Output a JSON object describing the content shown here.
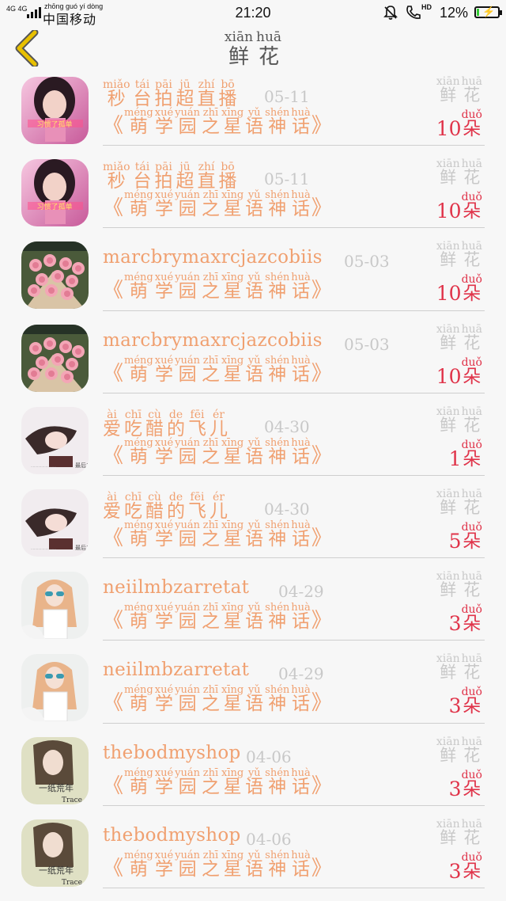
{
  "status_bar": {
    "network": "4G 4G",
    "carrier_pinyin": [
      "zhōng",
      "guó",
      "yí",
      "dòng"
    ],
    "carrier": [
      "中",
      "国",
      "移",
      "动"
    ],
    "time": "21:20",
    "hd": "HD",
    "battery_pct": "12%",
    "battery_level": 0.12
  },
  "header": {
    "title": [
      {
        "py": "xiān",
        "hz": "鲜"
      },
      {
        "py": "huā",
        "hz": "花"
      }
    ]
  },
  "flower_label": [
    {
      "py": "xiān",
      "hz": "鲜"
    },
    {
      "py": "huā",
      "hz": "花"
    }
  ],
  "unit": {
    "py": "duǒ",
    "hz": "朵"
  },
  "show_title": [
    {
      "py": "méng",
      "hz": "萌"
    },
    {
      "py": "xué",
      "hz": "学"
    },
    {
      "py": "yuán",
      "hz": "园"
    },
    {
      "py": "zhī",
      "hz": "之"
    },
    {
      "py": "xīng",
      "hz": "星"
    },
    {
      "py": "yǔ",
      "hz": "语"
    },
    {
      "py": "shén",
      "hz": "神"
    },
    {
      "py": "huà",
      "hz": "话"
    }
  ],
  "brackets": {
    "open": "《",
    "close": "》"
  },
  "rows": [
    {
      "name_type": "cn",
      "name": [
        {
          "py": "miǎo",
          "hz": "秒"
        },
        {
          "py": "tái",
          "hz": "台"
        },
        {
          "py": "pāi",
          "hz": "拍"
        },
        {
          "py": "jū",
          "hz": "超"
        },
        {
          "py": "zhí",
          "hz": "直"
        },
        {
          "py": "bō",
          "hz": "播"
        }
      ],
      "date": "05-11",
      "count": "10",
      "avatar": "girl-pink"
    },
    {
      "name_type": "cn",
      "name": [
        {
          "py": "miǎo",
          "hz": "秒"
        },
        {
          "py": "tái",
          "hz": "台"
        },
        {
          "py": "pāi",
          "hz": "拍"
        },
        {
          "py": "jū",
          "hz": "超"
        },
        {
          "py": "zhí",
          "hz": "直"
        },
        {
          "py": "bō",
          "hz": "播"
        }
      ],
      "date": "05-11",
      "count": "10",
      "avatar": "girl-pink"
    },
    {
      "name_type": "latin",
      "name_text": "marcbrymaxrcjazcobiis",
      "date": "05-03",
      "count": "10",
      "avatar": "roses"
    },
    {
      "name_type": "latin",
      "name_text": "marcbrymaxrcjazcobiis",
      "date": "05-03",
      "count": "10",
      "avatar": "roses"
    },
    {
      "name_type": "cn",
      "name": [
        {
          "py": "ài",
          "hz": "爱"
        },
        {
          "py": "chī",
          "hz": "吃"
        },
        {
          "py": "cù",
          "hz": "醋"
        },
        {
          "py": "de",
          "hz": "的"
        },
        {
          "py": "fēi",
          "hz": "飞"
        },
        {
          "py": "ér",
          "hz": "儿"
        }
      ],
      "date": "04-30",
      "count": "1",
      "avatar": "girl-lying"
    },
    {
      "name_type": "cn",
      "name": [
        {
          "py": "ài",
          "hz": "爱"
        },
        {
          "py": "chī",
          "hz": "吃"
        },
        {
          "py": "cù",
          "hz": "醋"
        },
        {
          "py": "de",
          "hz": "的"
        },
        {
          "py": "fēi",
          "hz": "飞"
        },
        {
          "py": "ér",
          "hz": "儿"
        }
      ],
      "date": "04-30",
      "count": "5",
      "avatar": "girl-lying"
    },
    {
      "name_type": "latin",
      "name_text": "neiilmbzarretat",
      "date": "04-29",
      "count": "3",
      "avatar": "girl-sunglasses"
    },
    {
      "name_type": "latin",
      "name_text": "neiilmbzarretat",
      "date": "04-29",
      "count": "3",
      "avatar": "girl-sunglasses"
    },
    {
      "name_type": "latin",
      "name_text": "thebodmyshop",
      "date": "04-06",
      "count": "3",
      "avatar": "girl-trace"
    },
    {
      "name_type": "latin",
      "name_text": "thebodmyshop",
      "date": "04-06",
      "count": "3",
      "avatar": "girl-trace"
    }
  ],
  "avatar_captions": {
    "girl-pink": "习惯了孤单",
    "girl-lying": "最后1",
    "girl-trace": "一纸荒年",
    "girl-trace-2": "Trace"
  },
  "colors": {
    "name": "#f0a070",
    "count": "#e0344a",
    "muted": "#c8c8c8",
    "back_arrow": "#e8c000",
    "background": "#f7f7f7"
  }
}
